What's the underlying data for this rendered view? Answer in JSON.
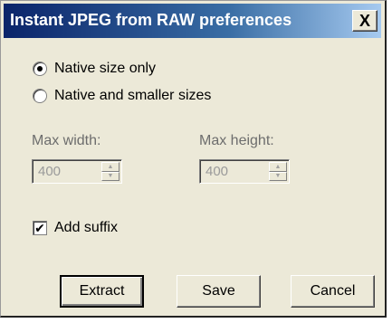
{
  "window": {
    "title": "Instant JPEG from RAW preferences",
    "close_label": "X"
  },
  "size_options": [
    {
      "label": "Native size only",
      "selected": true
    },
    {
      "label": "Native and smaller sizes",
      "selected": false
    }
  ],
  "max_width": {
    "label": "Max width:",
    "value": "400",
    "enabled": false
  },
  "max_height": {
    "label": "Max height:",
    "value": "400",
    "enabled": false
  },
  "add_suffix": {
    "label": "Add suffix",
    "checked": true,
    "mark": "✔"
  },
  "buttons": {
    "extract": "Extract",
    "save": "Save",
    "cancel": "Cancel"
  },
  "spinner_arrows": {
    "up": "▲",
    "down": "▼"
  }
}
